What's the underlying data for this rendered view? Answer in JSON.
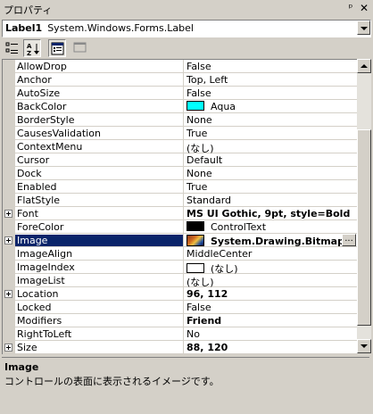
{
  "window": {
    "title": "プロパティ",
    "pin_glyph": "ᵖ",
    "close_glyph": "✕"
  },
  "object_selector": {
    "name": "Label1",
    "type": "System.Windows.Forms.Label"
  },
  "toolbar": {
    "buttons": [
      {
        "name": "categorized-view-button",
        "icon": "categorized-icon",
        "pressed": false
      },
      {
        "name": "alphabetical-view-button",
        "icon": "sort-az-icon",
        "pressed": true
      },
      {
        "name": "properties-view-button",
        "icon": "properties-icon",
        "pressed": true
      },
      {
        "name": "property-pages-button",
        "icon": "property-pages-icon",
        "pressed": false
      }
    ]
  },
  "properties": [
    {
      "name": "AllowDrop",
      "value": "False"
    },
    {
      "name": "Anchor",
      "value": "Top, Left"
    },
    {
      "name": "AutoSize",
      "value": "False"
    },
    {
      "name": "BackColor",
      "value": "Aqua",
      "swatch": "#00ffff"
    },
    {
      "name": "BorderStyle",
      "value": "None"
    },
    {
      "name": "CausesValidation",
      "value": "True"
    },
    {
      "name": "ContextMenu",
      "value": "(なし)"
    },
    {
      "name": "Cursor",
      "value": "Default"
    },
    {
      "name": "Dock",
      "value": "None"
    },
    {
      "name": "Enabled",
      "value": "True"
    },
    {
      "name": "FlatStyle",
      "value": "Standard"
    },
    {
      "name": "Font",
      "value": "MS UI Gothic, 9pt, style=Bold",
      "expandable": true,
      "bold": true
    },
    {
      "name": "ForeColor",
      "value": "ControlText",
      "swatch": "#000000"
    },
    {
      "name": "Image",
      "value": "System.Drawing.Bitmap",
      "expandable": true,
      "bold": true,
      "bitmap": true,
      "selected": true,
      "ellipsis": "..."
    },
    {
      "name": "ImageAlign",
      "value": "MiddleCenter"
    },
    {
      "name": "ImageIndex",
      "value": "(なし)",
      "swatch": "#ffffff"
    },
    {
      "name": "ImageList",
      "value": "(なし)"
    },
    {
      "name": "Location",
      "value": "96, 112",
      "expandable": true,
      "bold": true
    },
    {
      "name": "Locked",
      "value": "False"
    },
    {
      "name": "Modifiers",
      "value": "Friend",
      "bold": true
    },
    {
      "name": "RightToLeft",
      "value": "No"
    },
    {
      "name": "Size",
      "value": "88, 120",
      "expandable": true,
      "bold": true
    }
  ],
  "scrollbar": {
    "thumb_start_fraction": 0.21,
    "thumb_size_fraction": 0.74
  },
  "description": {
    "title": "Image",
    "text": "コントロールの表面に表示されるイメージです。"
  }
}
